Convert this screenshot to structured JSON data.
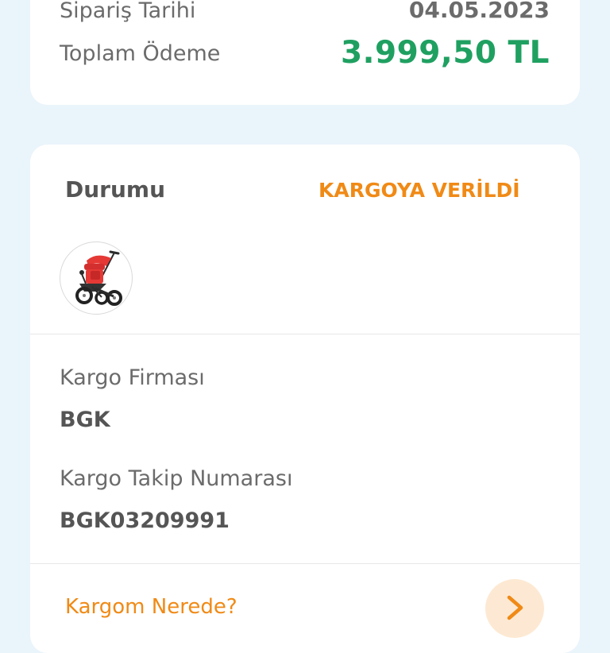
{
  "summary": {
    "clipped_label": "Sipariş Tarihi",
    "clipped_value": "04.05.2023",
    "total_label": "Toplam Ödeme",
    "total_value": "3.999,50 TL"
  },
  "status": {
    "label": "Durumu",
    "value": "KARGOYA VERİLDİ"
  },
  "product": {
    "image": "tricycle-thumbnail"
  },
  "shipment": {
    "carrier_label": "Kargo Firması",
    "carrier_value": "BGK",
    "tracking_label": "Kargo Takip Numarası",
    "tracking_value": "BGK03209991"
  },
  "where_link": "Kargom Nerede?",
  "colors": {
    "page_bg": "#eaf4fb",
    "card_bg": "#ffffff",
    "total": "#1fa061",
    "accent": "#f08a16",
    "arrow_bg": "#fde9d3"
  },
  "icons": {
    "arrow": "chevron-right-icon"
  }
}
